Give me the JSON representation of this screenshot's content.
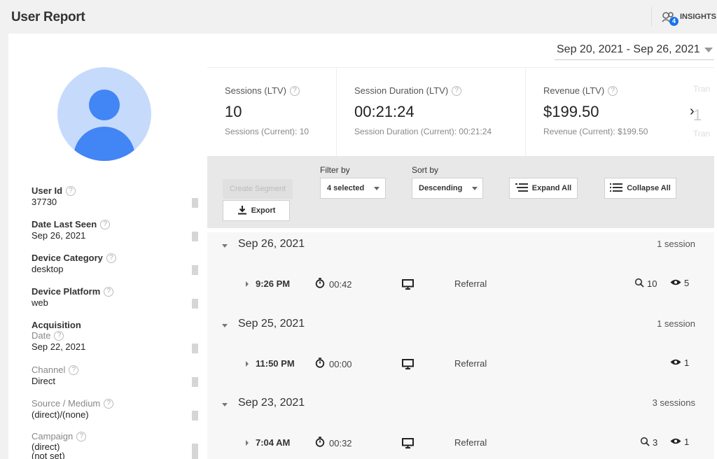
{
  "header": {
    "title": "User Report",
    "insights_label": "INSIGHTS",
    "insights_badge": "4"
  },
  "date_range": "Sep 20, 2021 - Sep 26, 2021",
  "attributes": {
    "user_id": {
      "label": "User Id",
      "value": "37730"
    },
    "date_last_seen": {
      "label": "Date Last Seen",
      "value": "Sep 26, 2021"
    },
    "device_category": {
      "label": "Device Category",
      "value": "desktop"
    },
    "device_platform": {
      "label": "Device Platform",
      "value": "web"
    },
    "acquisition": {
      "label": "Acquisition",
      "date": {
        "label": "Date",
        "value": "Sep 22, 2021"
      },
      "channel": {
        "label": "Channel",
        "value": "Direct"
      },
      "source_medium": {
        "label": "Source / Medium",
        "value": "(direct)/(none)"
      },
      "campaign": {
        "label": "Campaign",
        "value": "(direct)",
        "value2": "(not set)"
      }
    }
  },
  "metrics": [
    {
      "label": "Sessions (LTV)",
      "value": "10",
      "current": "Sessions (Current): 10"
    },
    {
      "label": "Session Duration (LTV)",
      "value": "00:21:24",
      "current": "Session Duration (Current): 00:21:24"
    },
    {
      "label": "Revenue (LTV)",
      "value": "$199.50",
      "current": "Revenue (Current): $199.50"
    }
  ],
  "metrics_next": "›",
  "metrics_peek": {
    "label": "Tran",
    "value": "1",
    "current": "Tran"
  },
  "toolbar": {
    "create_segment": "Create Segment",
    "export": "Export",
    "filter_by_label": "Filter by",
    "filter_by_value": "4 selected",
    "sort_by_label": "Sort by",
    "sort_by_value": "Descending",
    "expand_all": "Expand All",
    "collapse_all": "Collapse All"
  },
  "days": [
    {
      "date": "Sep 26, 2021",
      "count": "1 session",
      "sessions": [
        {
          "time": "9:26 PM",
          "duration": "00:42",
          "channel": "Referral",
          "goals": "10",
          "views": "5"
        }
      ]
    },
    {
      "date": "Sep 25, 2021",
      "count": "1 session",
      "sessions": [
        {
          "time": "11:50 PM",
          "duration": "00:00",
          "channel": "Referral",
          "goals": "",
          "views": "1"
        }
      ]
    },
    {
      "date": "Sep 23, 2021",
      "count": "3 sessions",
      "sessions": [
        {
          "time": "7:04 AM",
          "duration": "00:32",
          "channel": "Referral",
          "goals": "3",
          "views": "1"
        }
      ]
    }
  ],
  "icons": {
    "help": "?",
    "colors": {
      "accent": "#1a73e8",
      "avatar_bg": "#c6dafc",
      "avatar_fg": "#4285f4"
    }
  }
}
